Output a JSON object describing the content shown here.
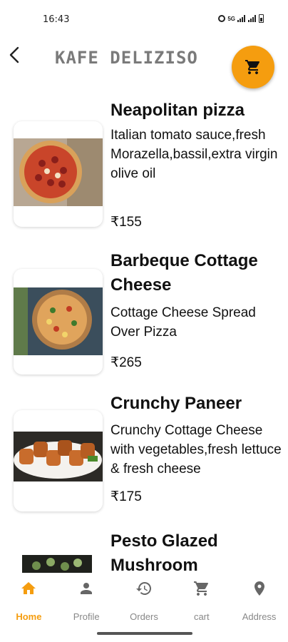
{
  "status_bar": {
    "time": "16:43",
    "network_label": "5G"
  },
  "header": {
    "title": "Kafe Deliziso",
    "accent_color": "#f59d0f",
    "back_icon": "arrow-back-icon",
    "cart_icon": "shopping-cart-icon"
  },
  "menu": {
    "items": [
      {
        "name": "Neapolitan pizza",
        "description": "Italian tomato sauce,fresh Morazella,bassil,extra virgin olive oil",
        "price": "₹155"
      },
      {
        "name": "Barbeque Cottage Cheese",
        "description": "Cottage Cheese Spread Over Pizza",
        "price": "₹265"
      },
      {
        "name": "Crunchy Paneer",
        "description": "Crunchy Cottage Cheese with vegetables,fresh lettuce & fresh cheese",
        "price": "₹175"
      },
      {
        "name": "Pesto Glazed Mushroom",
        "description": "",
        "price": ""
      }
    ]
  },
  "bottom_nav": {
    "items": [
      {
        "label": "Home",
        "icon": "home-icon",
        "active": true
      },
      {
        "label": "Profile",
        "icon": "person-icon",
        "active": false
      },
      {
        "label": "Orders",
        "icon": "history-icon",
        "active": false
      },
      {
        "label": "cart",
        "icon": "shopping-cart-icon",
        "active": false
      },
      {
        "label": "Address",
        "icon": "location-pin-icon",
        "active": false
      }
    ]
  }
}
